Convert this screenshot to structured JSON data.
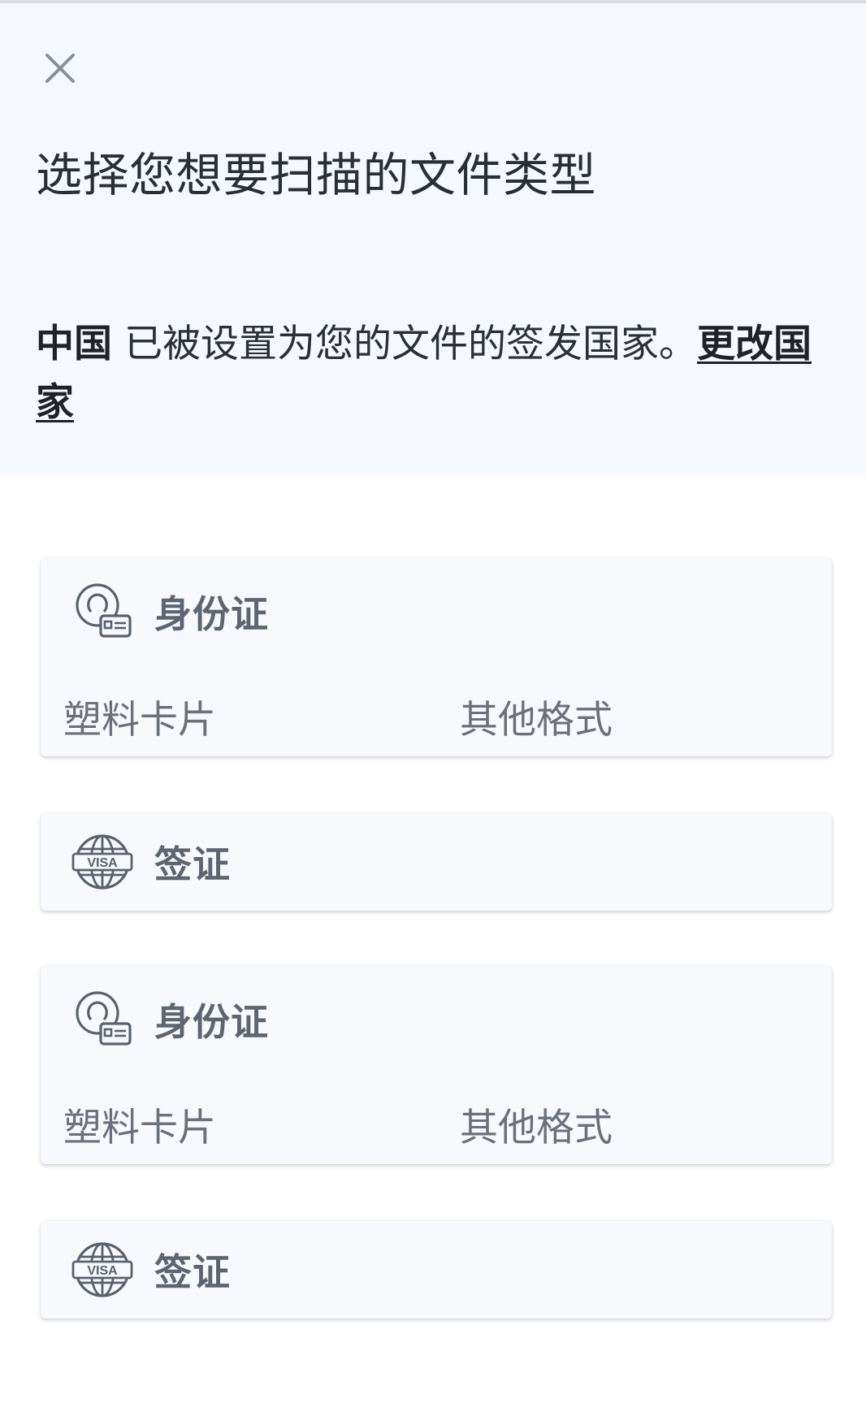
{
  "header": {
    "close_icon": "close-icon",
    "title": "选择您想要扫描的文件类型",
    "country_name": "中国",
    "country_text": " 已被设置为您的文件的签发国家。",
    "change_link": "更改国家"
  },
  "cards": [
    {
      "type": "id",
      "icon": "id-card-icon",
      "title": "身份证",
      "options": [
        "塑料卡片",
        "其他格式"
      ]
    },
    {
      "type": "visa",
      "icon": "visa-globe-icon",
      "title": "签证"
    },
    {
      "type": "id",
      "icon": "id-card-icon",
      "title": "身份证",
      "options": [
        "塑料卡片",
        "其他格式"
      ]
    },
    {
      "type": "visa",
      "icon": "visa-globe-icon",
      "title": "签证"
    }
  ],
  "colors": {
    "header_bg": "#f5f8fc",
    "card_bg": "#f7f9fc",
    "title_text": "#2a2e35",
    "card_title": "#5e6470",
    "option_text": "#6b707a"
  }
}
